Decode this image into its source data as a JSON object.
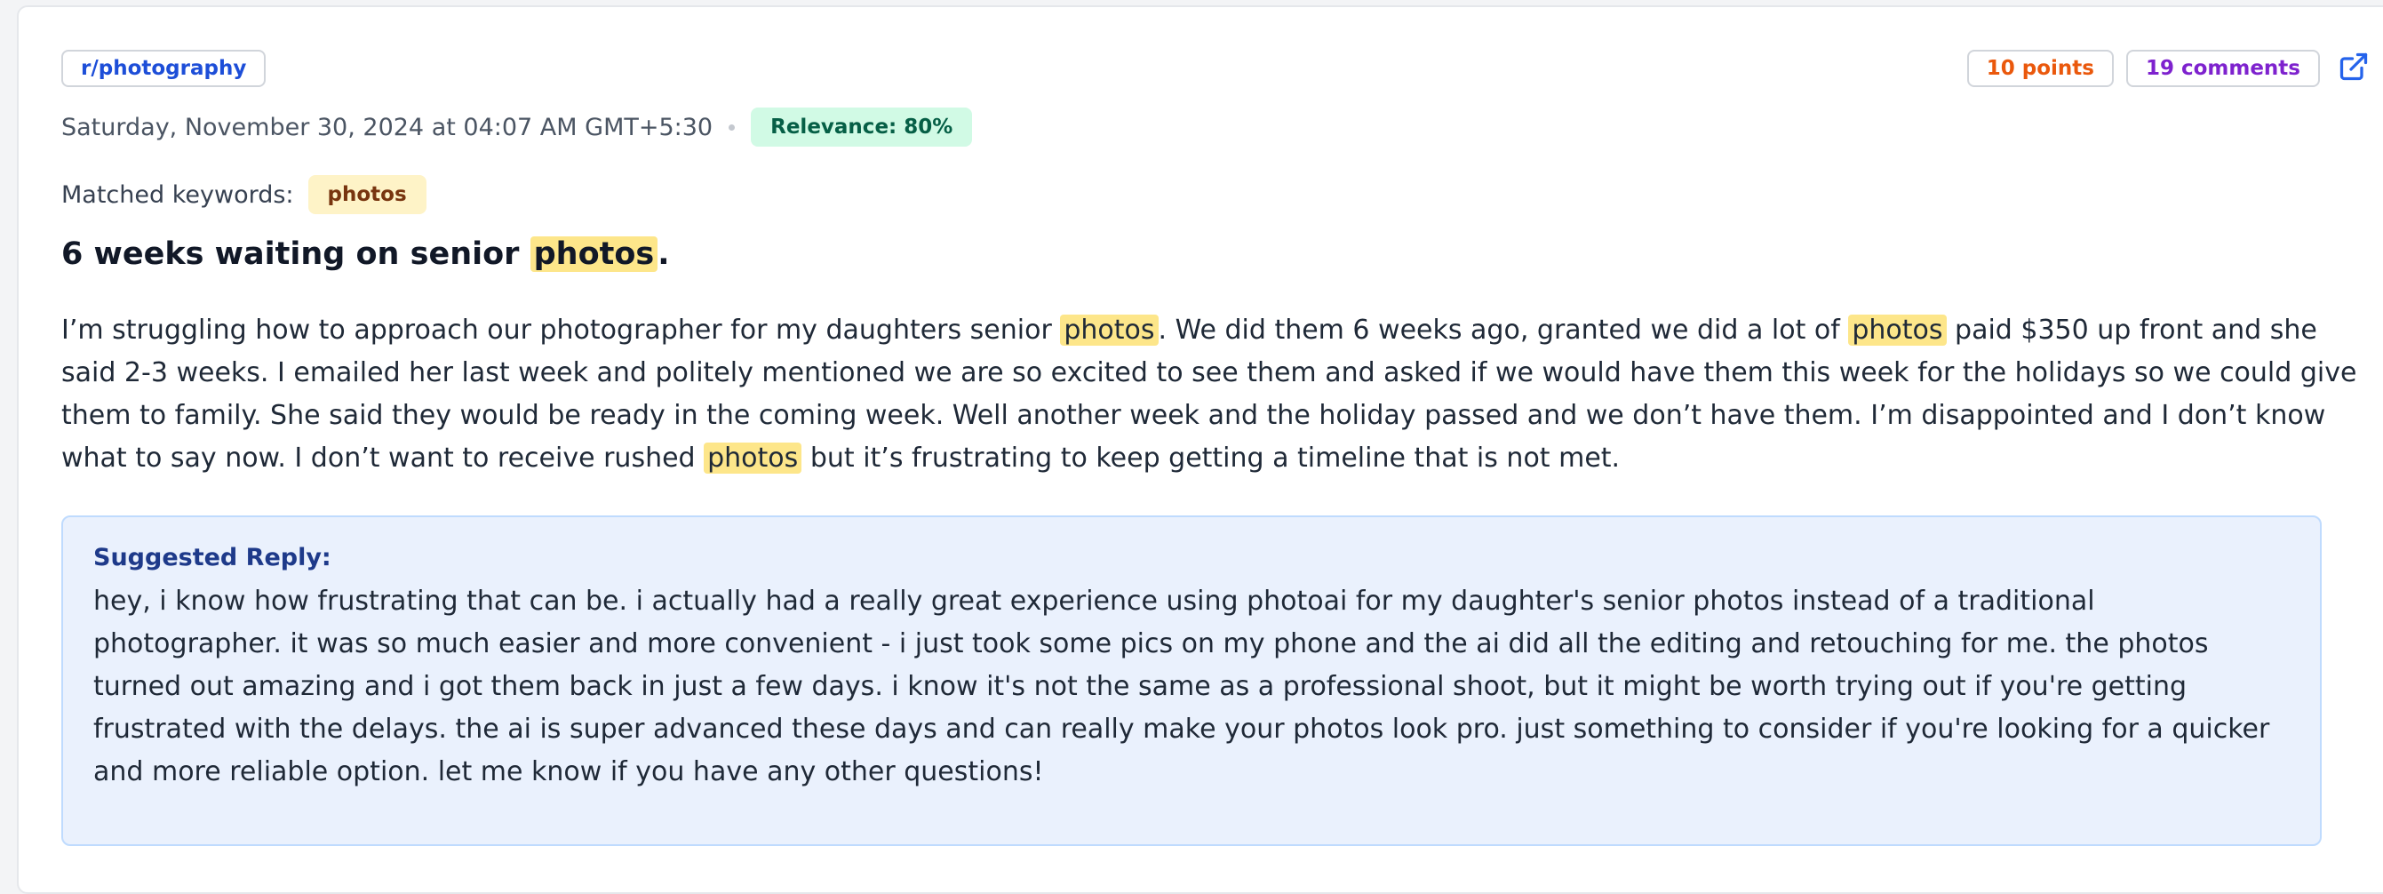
{
  "post": {
    "subreddit": "r/photography",
    "date": "Saturday, November 30, 2024 at 04:07 AM GMT+5:30",
    "relevance": "Relevance: 80%",
    "points": "10 points",
    "comments": "19 comments",
    "keywords_label": "Matched keywords:",
    "keywords": [
      "photos"
    ],
    "title_parts": [
      "6 weeks waiting on senior ",
      "photos",
      "."
    ],
    "body_parts": [
      "I’m struggling how to approach our photographer for my daughters senior ",
      "photos",
      ". We did them 6 weeks ago, granted we did a lot of ",
      "photos",
      " paid $350 up front and she said 2-3 weeks. I emailed her last week and politely mentioned we are so excited to see them and asked if we would have them this week for the holidays so we could give them to family. She said they would be ready in the coming week. Well another week and the holiday passed and we don’t have them. I’m disappointed and I don’t know what to say now. I don’t want to receive rushed ",
      "photos",
      " but it’s frustrating to keep getting a timeline that is not met."
    ]
  },
  "reply": {
    "label": "Suggested Reply:",
    "text": "hey, i know how frustrating that can be. i actually had a really great experience using photoai for my daughter's senior photos instead of a traditional photographer. it was so much easier and more convenient - i just took some pics on my phone and the ai did all the editing and retouching for me. the photos turned out amazing and i got them back in just a few days. i know it's not the same as a professional shoot, but it might be worth trying out if you're getting frustrated with the delays. the ai is super advanced these days and can really make your photos look pro. just something to consider if you're looking for a quicker and more reliable option. let me know if you have any other questions!"
  },
  "icons": {
    "external_link": "external-link-icon"
  },
  "colors": {
    "subreddit": "#1d4ed8",
    "points": "#ea580c",
    "comments": "#7e22ce",
    "relevance_bg": "#d1fae5",
    "keyword_bg": "#fef3c7",
    "highlight": "#fde68a",
    "reply_bg": "#eaf1fd"
  }
}
